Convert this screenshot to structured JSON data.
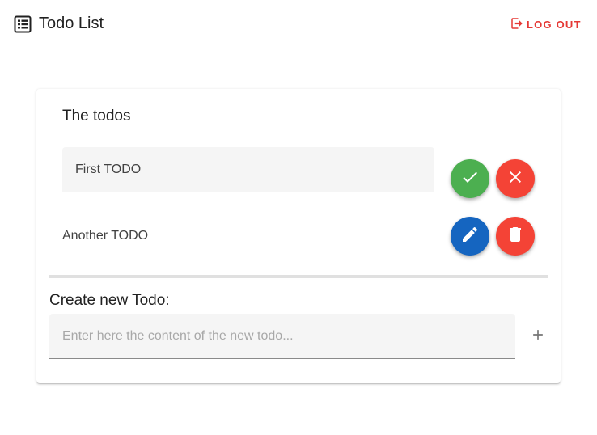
{
  "app": {
    "title": "Todo List",
    "icon": "list-alt-icon"
  },
  "header": {
    "logout_label": "LOG OUT",
    "logout_icon": "logout-icon"
  },
  "card": {
    "title": "The todos",
    "todos": [
      {
        "text": "First TODO",
        "mode": "editing",
        "actions": [
          {
            "name": "confirm",
            "icon": "check-icon",
            "color": "#4caf50"
          },
          {
            "name": "cancel",
            "icon": "close-icon",
            "color": "#f44336"
          }
        ]
      },
      {
        "text": "Another TODO",
        "mode": "view",
        "actions": [
          {
            "name": "edit",
            "icon": "pencil-icon",
            "color": "#1565c0"
          },
          {
            "name": "delete",
            "icon": "trash-icon",
            "color": "#f44336"
          }
        ]
      }
    ],
    "create": {
      "label": "Create new Todo:",
      "placeholder": "Enter here the content of the new todo...",
      "value": "",
      "add_icon": "plus-icon"
    }
  },
  "colors": {
    "accent_red": "#e53935",
    "confirm_green": "#4caf50",
    "danger_red": "#f44336",
    "edit_blue": "#1565c0"
  }
}
